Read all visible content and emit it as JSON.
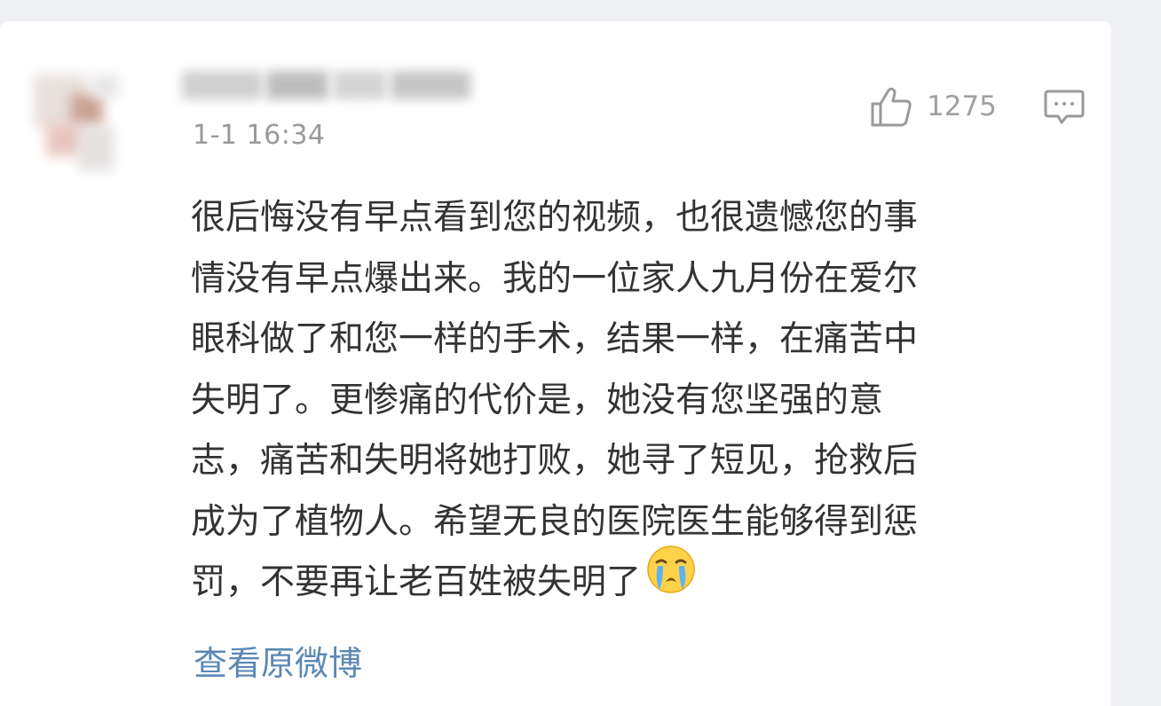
{
  "comment": {
    "timestamp": "1-1 16:34",
    "likes": "1275",
    "text_lines": [
      "很后悔没有早点看到您的视频，也很遗憾您的事",
      "情没有早点爆出来。我的一位家人九月份在爱尔",
      "眼科做了和您一样的手术，结果一样，在痛苦中",
      "失明了。更惨痛的代价是，她没有您坚强的意",
      "志，痛苦和失明将她打败，她寻了短见，抢救后",
      "成为了植物人。希望无良的医院医生能够得到惩",
      "罚，不要再让老百姓被失明了"
    ],
    "emoji": "crying-face-emoji",
    "view_original_label": "查看原微博"
  },
  "icons": {
    "like": "thumbs-up-icon",
    "comment": "comment-bubble-icon"
  },
  "colors": {
    "background": "#eef0f3",
    "card": "#ffffff",
    "body_text": "#333333",
    "meta_text": "#9a9a9a",
    "link": "#5b88b5"
  }
}
